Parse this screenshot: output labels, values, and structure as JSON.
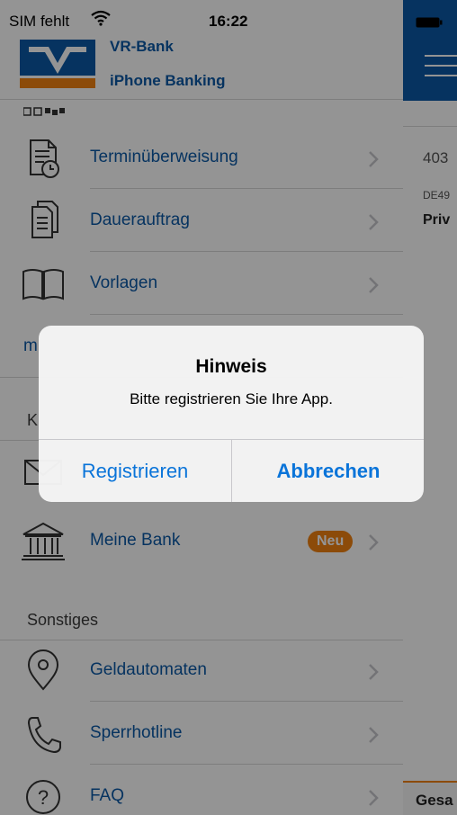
{
  "status_bar": {
    "carrier": "SIM fehlt",
    "time": "16:22"
  },
  "brand": {
    "name": "VR-Bank",
    "app": "iPhone Banking",
    "color": "#0b59a6"
  },
  "menu": {
    "items_top": [
      {
        "label": "Terminüberweisung",
        "icon": "calendar-document-icon"
      },
      {
        "label": "Dauerauftrag",
        "icon": "documents-stack-icon"
      },
      {
        "label": "Vorlagen",
        "icon": "open-book-icon"
      }
    ],
    "partial_text_1": "m",
    "section_k_partial": "K",
    "meine_bank": {
      "label": "Meine Bank",
      "badge": "Neu",
      "icon": "bank-building-icon"
    },
    "sonstiges": {
      "header": "Sonstiges",
      "items": [
        {
          "label": "Geldautomaten",
          "icon": "location-pin-icon"
        },
        {
          "label": "Sperrhotline",
          "icon": "phone-icon"
        },
        {
          "label": "FAQ",
          "icon": "question-icon"
        }
      ]
    }
  },
  "main_panel": {
    "account_number_partial": "403",
    "iban_partial": "DE49",
    "account_name_partial": "Priv",
    "footer_partial": "Gesa"
  },
  "alert": {
    "title": "Hinweis",
    "message": "Bitte registrieren Sie Ihre App.",
    "button_register": "Registrieren",
    "button_cancel": "Abbrechen"
  },
  "colors": {
    "accent": "#f18110",
    "link": "#0a74d9",
    "header": "#0b59a6"
  }
}
